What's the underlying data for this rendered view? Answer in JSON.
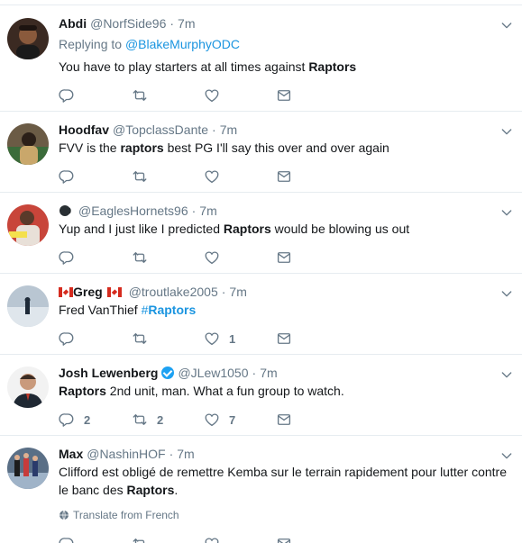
{
  "tweets": [
    {
      "fullname": "Abdi",
      "handle": "@NorfSide96",
      "time": "7m",
      "reply_prefix": "Replying to",
      "reply_to": "@BlakeMurphyODC",
      "text_before": "You have to play starters at all times against ",
      "text_bold": "Raptors",
      "text_after": "",
      "counts": {
        "reply": "",
        "retweet": "",
        "like": ""
      }
    },
    {
      "fullname": "Hoodfav",
      "handle": "@TopclassDante",
      "time": "7m",
      "text_before": "FVV is the ",
      "text_bold": "raptors",
      "text_after": " best PG I'll say this over and over again",
      "counts": {
        "reply": "",
        "retweet": "",
        "like": ""
      }
    },
    {
      "fullname": "",
      "handle": "@EaglesHornets96",
      "time": "7m",
      "text_before": "Yup and I just like I predicted ",
      "text_bold": "Raptors",
      "text_after": " would be blowing us out",
      "counts": {
        "reply": "",
        "retweet": "",
        "like": ""
      }
    },
    {
      "fullname": "Greg",
      "handle": "@troutlake2005",
      "time": "7m",
      "text_before": "Fred VanThief ",
      "hashtag_hash": "#",
      "hashtag_word": "Raptors",
      "counts": {
        "reply": "",
        "retweet": "",
        "like": "1"
      }
    },
    {
      "fullname": "Josh Lewenberg",
      "handle": "@JLew1050",
      "time": "7m",
      "text_bold": "Raptors",
      "text_after": " 2nd unit, man. What a fun group to watch.",
      "counts": {
        "reply": "2",
        "retweet": "2",
        "like": "7"
      }
    },
    {
      "fullname": "Max",
      "handle": "@NashinHOF",
      "time": "7m",
      "text_before": "Clifford est obligé de remettre Kemba sur le terrain rapidement pour lutter contre le banc des ",
      "text_bold": "Raptors",
      "text_after": ".",
      "translate": "Translate from French",
      "counts": {
        "reply": "",
        "retweet": "",
        "like": ""
      }
    }
  ],
  "separator": "·",
  "colors": {
    "link": "#1b95e0",
    "muted": "#657786",
    "text": "#14171a",
    "border": "#e6ecf0",
    "verified": "#1da1f2"
  },
  "icons": [
    "reply-icon",
    "retweet-icon",
    "like-icon",
    "direct-message-icon",
    "chevron-down-icon",
    "verified-badge-icon",
    "canada-flag-icon",
    "globe-icon"
  ]
}
